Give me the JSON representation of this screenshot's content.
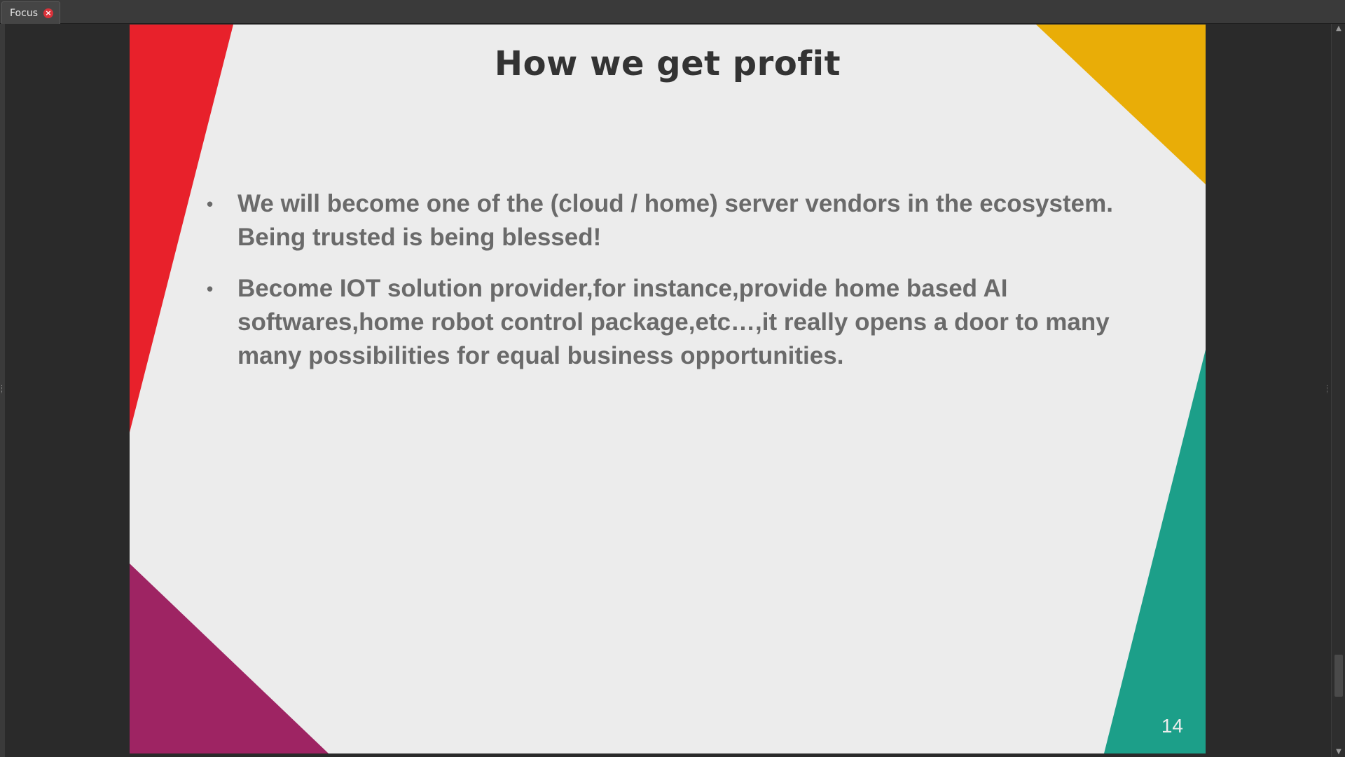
{
  "window": {
    "tab_label": "Focus",
    "tab_close_icon": "close-icon"
  },
  "slide": {
    "title": "How we get profit",
    "bullets": [
      "We will become one of the (cloud / home) server vendors in the ecosystem. Being trusted is being blessed!",
      "Become IOT solution provider,for instance,provide home based AI softwares,home robot control package,etc…,it really opens a door to many many possibilities for equal business opportunities."
    ],
    "bullet_symbol": "•",
    "page_number": "14",
    "colors": {
      "background": "#ececec",
      "red": "#e8212b",
      "yellow": "#e9ad07",
      "teal": "#1c9f89",
      "purple": "#9e2463",
      "title": "#333333",
      "body": "#6a6a6a"
    }
  },
  "scrollbar": {
    "up_icon": "scroll-up-arrow-icon",
    "down_icon": "scroll-down-arrow-icon"
  }
}
